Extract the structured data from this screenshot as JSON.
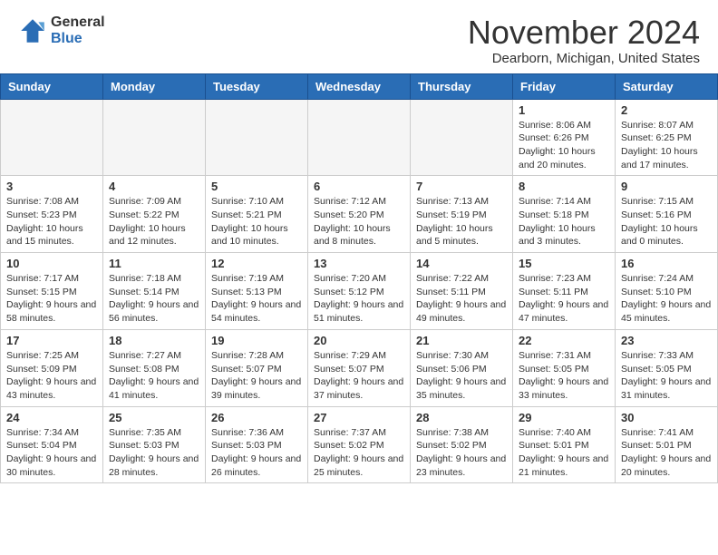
{
  "header": {
    "logo_general": "General",
    "logo_blue": "Blue",
    "month_title": "November 2024",
    "location": "Dearborn, Michigan, United States"
  },
  "calendar": {
    "days_of_week": [
      "Sunday",
      "Monday",
      "Tuesday",
      "Wednesday",
      "Thursday",
      "Friday",
      "Saturday"
    ],
    "weeks": [
      [
        {
          "day": "",
          "empty": true
        },
        {
          "day": "",
          "empty": true
        },
        {
          "day": "",
          "empty": true
        },
        {
          "day": "",
          "empty": true
        },
        {
          "day": "",
          "empty": true
        },
        {
          "day": "1",
          "sunrise": "8:06 AM",
          "sunset": "6:26 PM",
          "daylight": "10 hours and 20 minutes."
        },
        {
          "day": "2",
          "sunrise": "8:07 AM",
          "sunset": "6:25 PM",
          "daylight": "10 hours and 17 minutes."
        }
      ],
      [
        {
          "day": "3",
          "sunrise": "7:08 AM",
          "sunset": "5:23 PM",
          "daylight": "10 hours and 15 minutes."
        },
        {
          "day": "4",
          "sunrise": "7:09 AM",
          "sunset": "5:22 PM",
          "daylight": "10 hours and 12 minutes."
        },
        {
          "day": "5",
          "sunrise": "7:10 AM",
          "sunset": "5:21 PM",
          "daylight": "10 hours and 10 minutes."
        },
        {
          "day": "6",
          "sunrise": "7:12 AM",
          "sunset": "5:20 PM",
          "daylight": "10 hours and 8 minutes."
        },
        {
          "day": "7",
          "sunrise": "7:13 AM",
          "sunset": "5:19 PM",
          "daylight": "10 hours and 5 minutes."
        },
        {
          "day": "8",
          "sunrise": "7:14 AM",
          "sunset": "5:18 PM",
          "daylight": "10 hours and 3 minutes."
        },
        {
          "day": "9",
          "sunrise": "7:15 AM",
          "sunset": "5:16 PM",
          "daylight": "10 hours and 0 minutes."
        }
      ],
      [
        {
          "day": "10",
          "sunrise": "7:17 AM",
          "sunset": "5:15 PM",
          "daylight": "9 hours and 58 minutes."
        },
        {
          "day": "11",
          "sunrise": "7:18 AM",
          "sunset": "5:14 PM",
          "daylight": "9 hours and 56 minutes."
        },
        {
          "day": "12",
          "sunrise": "7:19 AM",
          "sunset": "5:13 PM",
          "daylight": "9 hours and 54 minutes."
        },
        {
          "day": "13",
          "sunrise": "7:20 AM",
          "sunset": "5:12 PM",
          "daylight": "9 hours and 51 minutes."
        },
        {
          "day": "14",
          "sunrise": "7:22 AM",
          "sunset": "5:11 PM",
          "daylight": "9 hours and 49 minutes."
        },
        {
          "day": "15",
          "sunrise": "7:23 AM",
          "sunset": "5:11 PM",
          "daylight": "9 hours and 47 minutes."
        },
        {
          "day": "16",
          "sunrise": "7:24 AM",
          "sunset": "5:10 PM",
          "daylight": "9 hours and 45 minutes."
        }
      ],
      [
        {
          "day": "17",
          "sunrise": "7:25 AM",
          "sunset": "5:09 PM",
          "daylight": "9 hours and 43 minutes."
        },
        {
          "day": "18",
          "sunrise": "7:27 AM",
          "sunset": "5:08 PM",
          "daylight": "9 hours and 41 minutes."
        },
        {
          "day": "19",
          "sunrise": "7:28 AM",
          "sunset": "5:07 PM",
          "daylight": "9 hours and 39 minutes."
        },
        {
          "day": "20",
          "sunrise": "7:29 AM",
          "sunset": "5:07 PM",
          "daylight": "9 hours and 37 minutes."
        },
        {
          "day": "21",
          "sunrise": "7:30 AM",
          "sunset": "5:06 PM",
          "daylight": "9 hours and 35 minutes."
        },
        {
          "day": "22",
          "sunrise": "7:31 AM",
          "sunset": "5:05 PM",
          "daylight": "9 hours and 33 minutes."
        },
        {
          "day": "23",
          "sunrise": "7:33 AM",
          "sunset": "5:05 PM",
          "daylight": "9 hours and 31 minutes."
        }
      ],
      [
        {
          "day": "24",
          "sunrise": "7:34 AM",
          "sunset": "5:04 PM",
          "daylight": "9 hours and 30 minutes."
        },
        {
          "day": "25",
          "sunrise": "7:35 AM",
          "sunset": "5:03 PM",
          "daylight": "9 hours and 28 minutes."
        },
        {
          "day": "26",
          "sunrise": "7:36 AM",
          "sunset": "5:03 PM",
          "daylight": "9 hours and 26 minutes."
        },
        {
          "day": "27",
          "sunrise": "7:37 AM",
          "sunset": "5:02 PM",
          "daylight": "9 hours and 25 minutes."
        },
        {
          "day": "28",
          "sunrise": "7:38 AM",
          "sunset": "5:02 PM",
          "daylight": "9 hours and 23 minutes."
        },
        {
          "day": "29",
          "sunrise": "7:40 AM",
          "sunset": "5:01 PM",
          "daylight": "9 hours and 21 minutes."
        },
        {
          "day": "30",
          "sunrise": "7:41 AM",
          "sunset": "5:01 PM",
          "daylight": "9 hours and 20 minutes."
        }
      ]
    ]
  }
}
